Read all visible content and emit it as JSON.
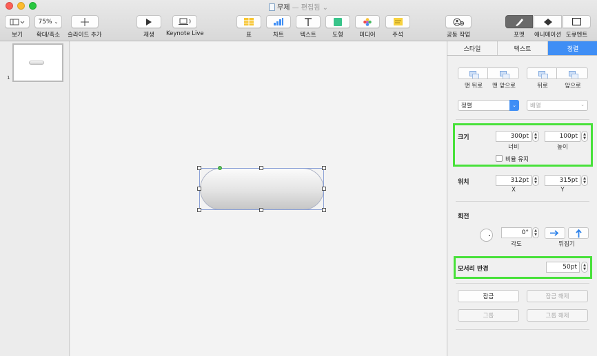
{
  "window": {
    "title": "무제",
    "subtitle": "— 편집됨",
    "lights": {
      "close": "#fc5f57",
      "minimize": "#fdbc2e",
      "zoom": "#28c840"
    }
  },
  "toolbar": {
    "view_label": "보기",
    "zoom_value": "75%",
    "zoom_label": "확대/축소",
    "add_slide_label": "슬라이드 추가",
    "play_label": "재생",
    "keynote_live_label": "Keynote Live",
    "table_label": "표",
    "chart_label": "차트",
    "text_label": "텍스트",
    "shape_label": "도형",
    "media_label": "미디어",
    "comment_label": "주석",
    "collaborate_label": "공동 작업",
    "format_label": "포맷",
    "animate_label": "애니메이션",
    "document_label": "도큐멘트"
  },
  "navigator": {
    "slide_number": "1"
  },
  "inspector": {
    "tabs": [
      "스타일",
      "텍스트",
      "정렬"
    ],
    "active_tab": 2,
    "arrange": {
      "back_label": "맨 뒤로",
      "front_label": "맨 앞으로",
      "backward_label": "뒤로",
      "forward_label": "앞으로",
      "align_value": "정렬",
      "distribute_value": "배열"
    },
    "size": {
      "title": "크기",
      "width": "300pt",
      "width_label": "너비",
      "height": "100pt",
      "height_label": "높이",
      "constrain_label": "비율 유지"
    },
    "position": {
      "title": "위치",
      "x": "312pt",
      "x_label": "X",
      "y": "315pt",
      "y_label": "Y"
    },
    "rotate": {
      "title": "회전",
      "angle": "0°",
      "angle_label": "각도",
      "flip_label": "뒤집기"
    },
    "corner_radius": {
      "title": "모서리 반경",
      "value": "50pt"
    },
    "lock_label": "잠금",
    "unlock_label": "잠금 해제",
    "group_label": "그룹",
    "ungroup_label": "그룹 해제"
  },
  "colors": {
    "accent": "#3f8ef5",
    "highlight": "#48e13a"
  }
}
